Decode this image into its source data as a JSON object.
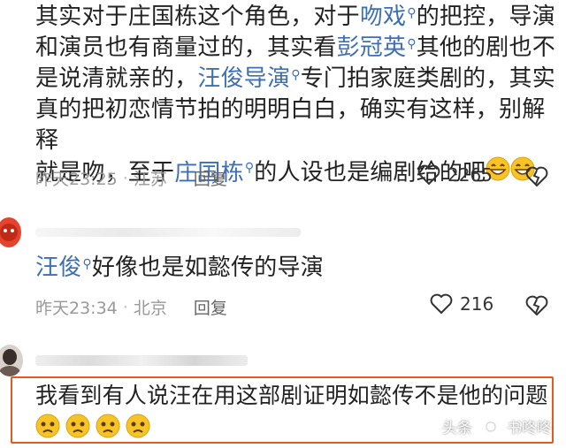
{
  "comments": [
    {
      "text_parts": {
        "p1": "其实对于庄国栋这个角色，对于",
        "l1": "吻戏",
        "p2": "的把控，导演",
        "p3": "和演员也有商量过的，其实看",
        "l2": "彭冠英",
        "p4": "其他的剧也不",
        "p5": "是说清就亲的，",
        "l3": "汪俊导演",
        "p6": "专门拍家庭类剧的，其实",
        "p7": "真的把初恋情节拍的明明白白，确实有这样，别解释",
        "p8": "就是吻，至于",
        "l4": "庄国栋",
        "p9": "的人设也是编剧给的吧"
      },
      "time": "昨天23:25",
      "location": "江苏",
      "reply_label": "回复",
      "like_count": "2265"
    },
    {
      "text_parts": {
        "l1": "汪俊",
        "p1": "好像也是如懿传的导演"
      },
      "time": "昨天23:34",
      "location": "北京",
      "reply_label": "回复",
      "like_count": "216"
    },
    {
      "text": "我看到有人说汪在用这部剧证明如懿传不是他的问题"
    }
  ],
  "watermark": {
    "platform": "头条",
    "account": "书咚咚"
  },
  "colors": {
    "link": "#3d6fb6",
    "highlight_border": "#e55a22"
  },
  "icons": [
    "search-icon",
    "heart-icon",
    "dislike-heart-icon",
    "grin-emoji-icon",
    "sad-emoji-icon"
  ]
}
